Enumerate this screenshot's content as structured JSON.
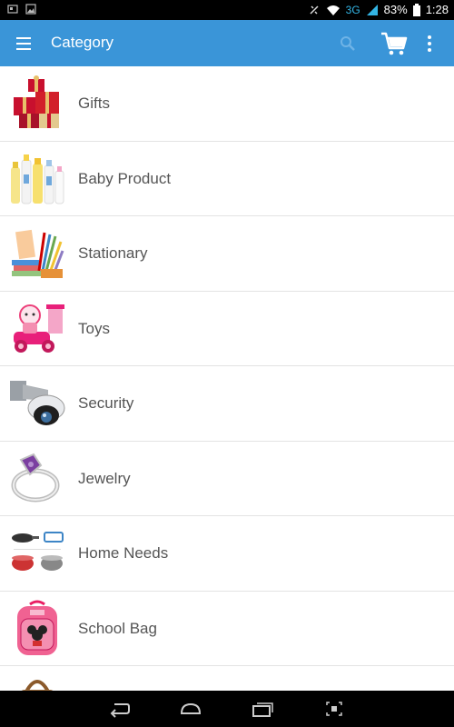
{
  "status_bar": {
    "network": "3G",
    "battery": "83%",
    "time": "1:28"
  },
  "app_bar": {
    "title": "Category",
    "menu_icon": "hamburger-menu-icon",
    "search_icon": "search-icon",
    "cart_icon": "shopping-cart-icon",
    "more_icon": "overflow-menu-icon"
  },
  "categories": [
    {
      "label": "Gifts",
      "icon": "gifts-thumbnail"
    },
    {
      "label": "Baby Product",
      "icon": "baby-product-thumbnail"
    },
    {
      "label": "Stationary",
      "icon": "stationary-thumbnail"
    },
    {
      "label": "Toys",
      "icon": "toys-thumbnail"
    },
    {
      "label": "Security",
      "icon": "security-camera-thumbnail"
    },
    {
      "label": "Jewelry",
      "icon": "ring-thumbnail"
    },
    {
      "label": "Home Needs",
      "icon": "cookware-thumbnail"
    },
    {
      "label": "School Bag",
      "icon": "school-bag-thumbnail"
    },
    {
      "label": "",
      "icon": "handbag-thumbnail"
    }
  ],
  "colors": {
    "app_bar": "#3a95d8",
    "label_text": "#555555",
    "divider": "#e3e3e3"
  }
}
